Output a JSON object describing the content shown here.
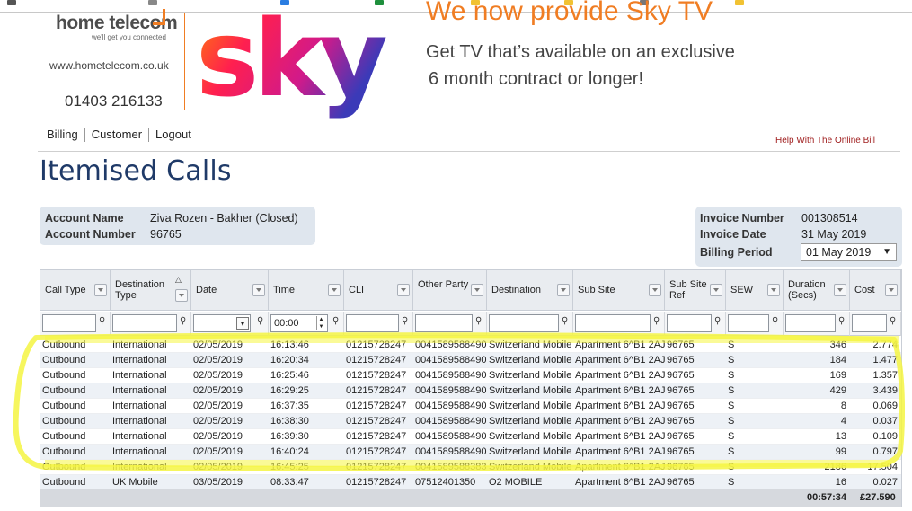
{
  "brand": {
    "name": "home telecom",
    "tagline": "we'll get you connected",
    "url": "www.hometelecom.co.uk",
    "phone": "01403 216133",
    "accent_color": "#f07d23"
  },
  "promo": {
    "logo_text": "sky",
    "headline": "We now provide Sky TV",
    "line1": "Get TV that’s available on an exclusive",
    "line2": "6 month contract or longer!"
  },
  "nav": {
    "items": [
      "Billing",
      "Customer",
      "Logout"
    ],
    "help": "Help With The Online Bill"
  },
  "page_title": "Itemised Calls",
  "account": {
    "name_label": "Account Name",
    "name_value": "Ziva Rozen - Bakher (Closed)",
    "number_label": "Account Number",
    "number_value": "96765"
  },
  "invoice": {
    "number_label": "Invoice Number",
    "number_value": "001308514",
    "date_label": "Invoice Date",
    "date_value": "31 May 2019",
    "period_label": "Billing Period",
    "period_value": "01 May 2019"
  },
  "grid": {
    "columns": [
      "Call Type",
      "Destination Type",
      "Date",
      "Time",
      "CLI",
      "Other Party",
      "Destination",
      "Sub Site",
      "Sub Site Ref",
      "SEW",
      "Duration (Secs)",
      "Cost"
    ],
    "time_filter_value": "00:00",
    "rows": [
      [
        "Outbound",
        "International",
        "02/05/2019",
        "16:13:46",
        "01215728247",
        "0041589588490",
        "Switzerland Mobile",
        "Apartment 6^B1 2AJ",
        "96765",
        "S",
        "346",
        "2.774"
      ],
      [
        "Outbound",
        "International",
        "02/05/2019",
        "16:20:34",
        "01215728247",
        "0041589588490",
        "Switzerland Mobile",
        "Apartment 6^B1 2AJ",
        "96765",
        "S",
        "184",
        "1.477"
      ],
      [
        "Outbound",
        "International",
        "02/05/2019",
        "16:25:46",
        "01215728247",
        "0041589588490",
        "Switzerland Mobile",
        "Apartment 6^B1 2AJ",
        "96765",
        "S",
        "169",
        "1.357"
      ],
      [
        "Outbound",
        "International",
        "02/05/2019",
        "16:29:25",
        "01215728247",
        "0041589588490",
        "Switzerland Mobile",
        "Apartment 6^B1 2AJ",
        "96765",
        "S",
        "429",
        "3.439"
      ],
      [
        "Outbound",
        "International",
        "02/05/2019",
        "16:37:35",
        "01215728247",
        "0041589588490",
        "Switzerland Mobile",
        "Apartment 6^B1 2AJ",
        "96765",
        "S",
        "8",
        "0.069"
      ],
      [
        "Outbound",
        "International",
        "02/05/2019",
        "16:38:30",
        "01215728247",
        "0041589588490",
        "Switzerland Mobile",
        "Apartment 6^B1 2AJ",
        "96765",
        "S",
        "4",
        "0.037"
      ],
      [
        "Outbound",
        "International",
        "02/05/2019",
        "16:39:30",
        "01215728247",
        "0041589588490",
        "Switzerland Mobile",
        "Apartment 6^B1 2AJ",
        "96765",
        "S",
        "13",
        "0.109"
      ],
      [
        "Outbound",
        "International",
        "02/05/2019",
        "16:40:24",
        "01215728247",
        "0041589588490",
        "Switzerland Mobile",
        "Apartment 6^B1 2AJ",
        "96765",
        "S",
        "99",
        "0.797"
      ],
      [
        "Outbound",
        "International",
        "02/05/2019",
        "16:45:25",
        "01215728247",
        "0041589588383",
        "Switzerland Mobile",
        "Apartment 6^B1 2AJ",
        "96765",
        "S",
        "2186",
        "17.504"
      ],
      [
        "Outbound",
        "UK Mobile",
        "03/05/2019",
        "08:33:47",
        "01215728247",
        "07512401350",
        "O2 MOBILE",
        "Apartment 6^B1 2AJ",
        "96765",
        "S",
        "16",
        "0.027"
      ]
    ],
    "total_duration": "00:57:34",
    "total_cost": "£27.590"
  },
  "colors": {
    "title": "#1f3a68",
    "highlighter": "#f5f542",
    "help_link": "#a01f1f"
  }
}
